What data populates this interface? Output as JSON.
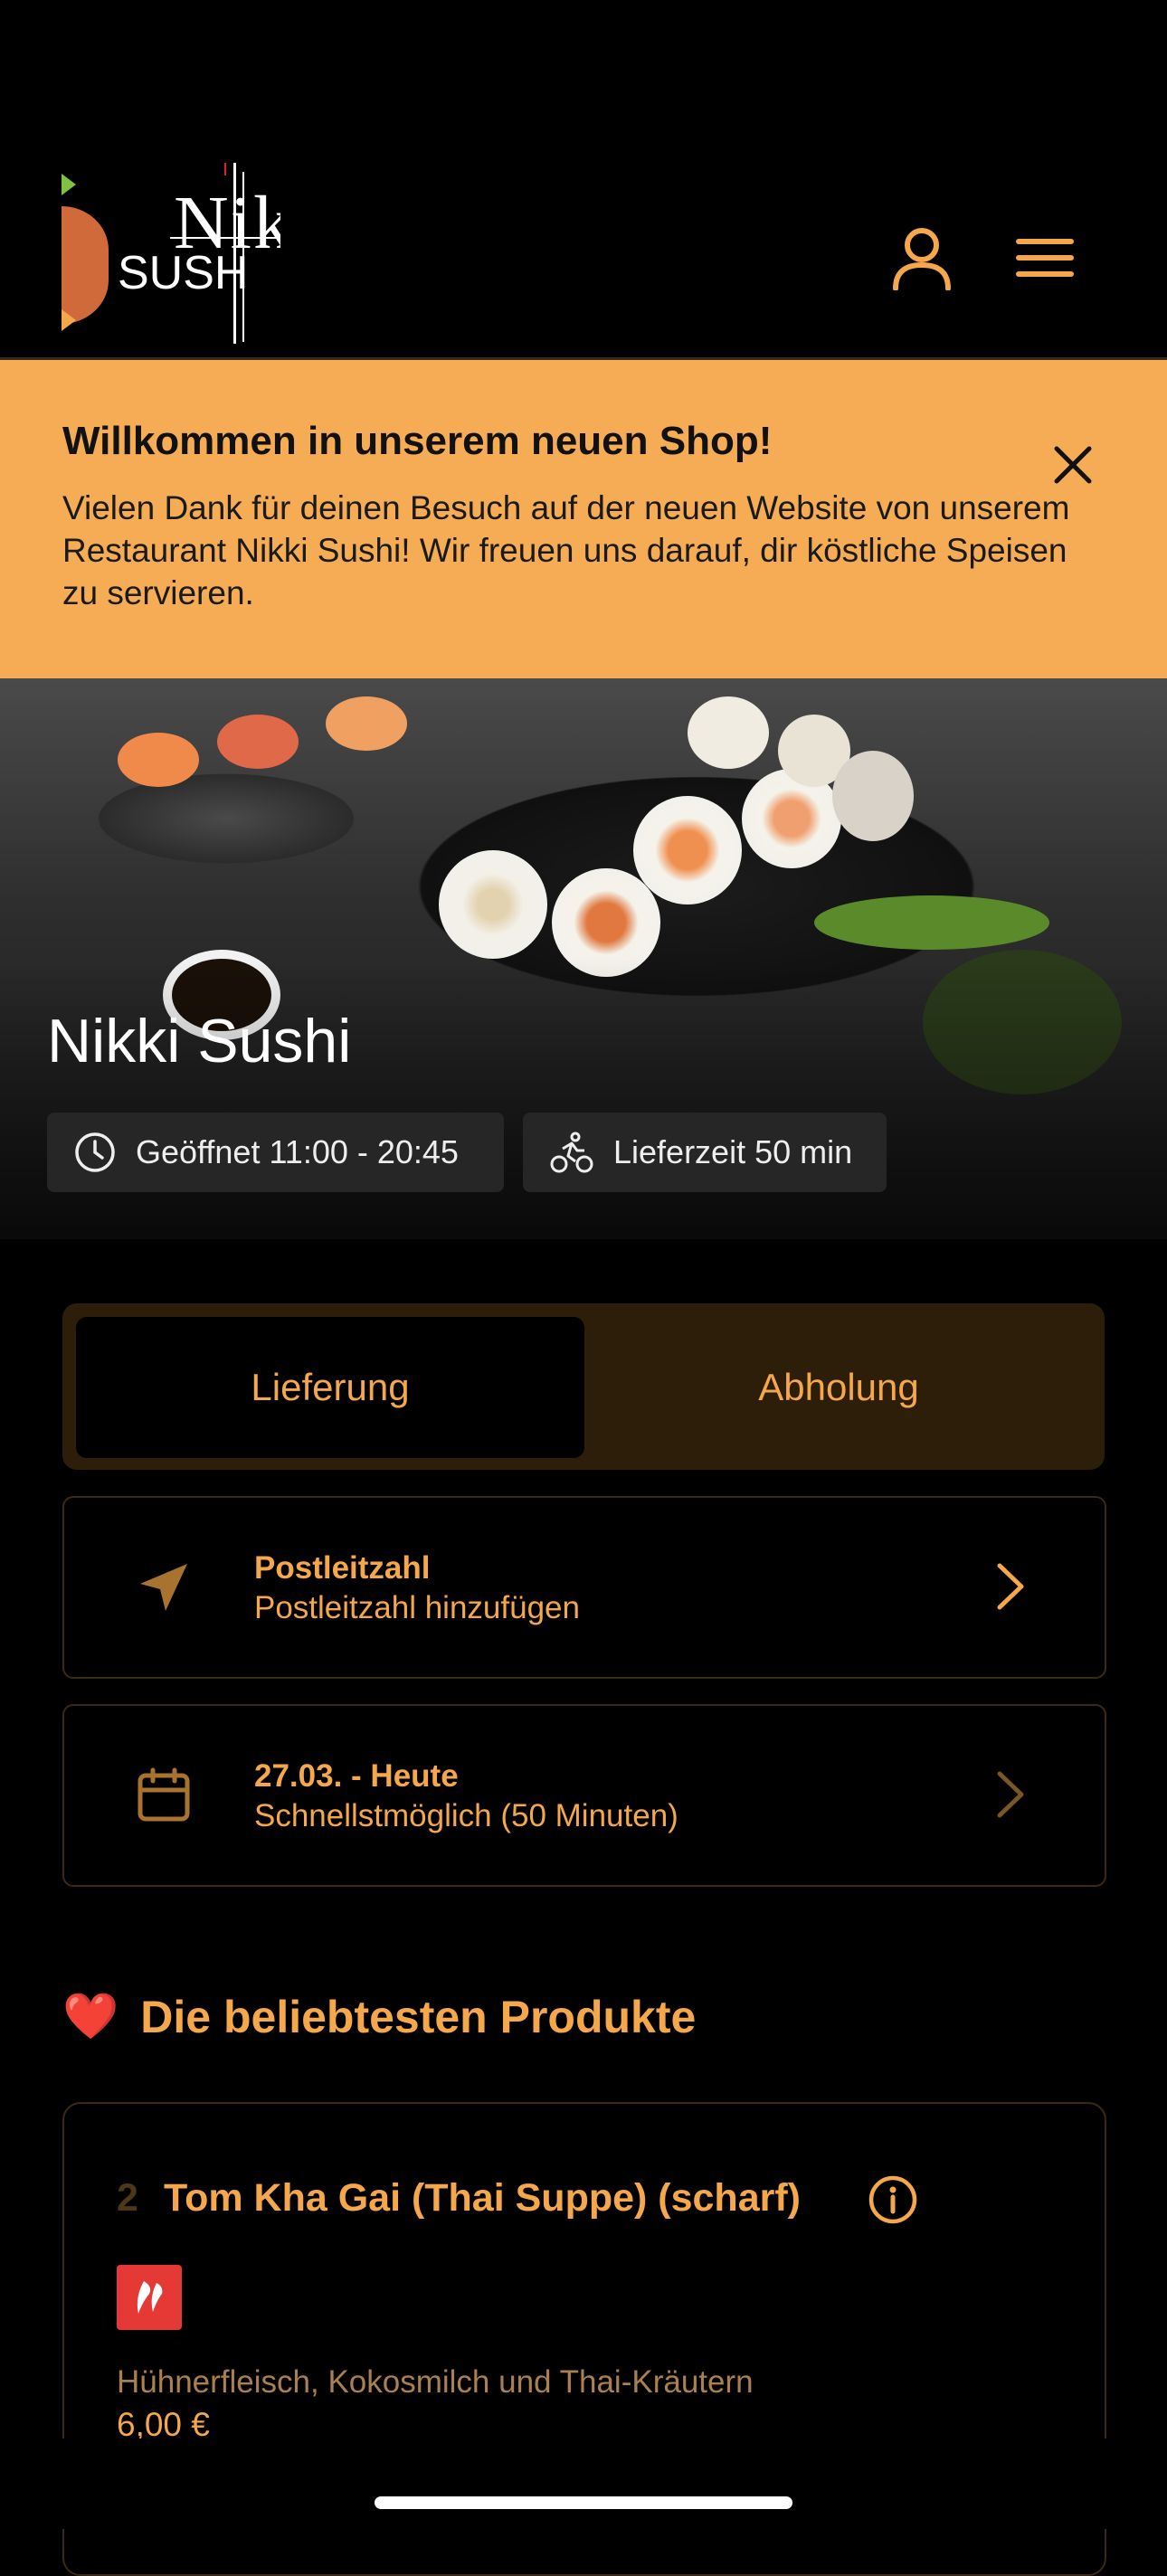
{
  "header": {
    "logo_text_top": "Nik",
    "logo_text_bottom": "SUSH",
    "account_icon": "user-icon",
    "menu_icon": "hamburger-menu-icon"
  },
  "banner": {
    "title": "Willkommen in unserem neuen Shop!",
    "text": "Vielen Dank für deinen Besuch auf der neuen Website von unserem Restaurant Nikki Sushi! Wir freuen uns darauf, dir köstliche Speisen zu servieren.",
    "close_icon": "close-icon"
  },
  "hero": {
    "restaurant_name": "Nikki Sushi",
    "opening_hours": "Geöffnet 11:00 - 20:45",
    "delivery_time": "Lieferzeit 50 min"
  },
  "order_mode": {
    "delivery_label": "Lieferung",
    "pickup_label": "Abholung",
    "selected": "Lieferung"
  },
  "options": {
    "postcode": {
      "title": "Postleitzahl",
      "subtitle": "Postleitzahl hinzufügen",
      "icon": "location-arrow-icon"
    },
    "date": {
      "title": "27.03. - Heute",
      "subtitle": "Schnellstmöglich (50 Minuten)",
      "icon": "calendar-icon"
    }
  },
  "popular": {
    "heart": "❤️",
    "title": "Die beliebtesten Produkte",
    "products": [
      {
        "number": "2",
        "name": "Tom Kha Gai (Thai Suppe) (scharf)",
        "description": "Hühnerfleisch, Kokosmilch und Thai-Kräutern",
        "price": "6,00 €",
        "badge_icon": "chili-spicy-icon"
      }
    ]
  },
  "colors": {
    "background": "#000000",
    "accent": "#f4a74b",
    "banner": "#f5ac54",
    "toggle_bg": "#2d1e0a",
    "spicy_badge": "#e53935"
  }
}
